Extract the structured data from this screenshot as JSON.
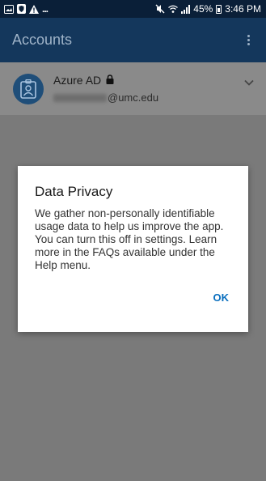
{
  "status_bar": {
    "battery": "45%",
    "time": "3:46 PM",
    "overflow": "..."
  },
  "app_bar": {
    "title": "Accounts"
  },
  "account": {
    "name": "Azure AD",
    "email_domain": "@umc.edu",
    "icon": "badge-icon",
    "lock_icon": "lock-icon"
  },
  "dialog": {
    "title": "Data Privacy",
    "body": "We gather non-personally identifiable usage data to help us improve the app. You can turn this off in settings. Learn more in the FAQs available under the Help menu.",
    "ok_label": "OK"
  },
  "colors": {
    "status_bar": "#0a1f38",
    "app_bar": "#14375c",
    "accent": "#0a6fbf",
    "scrim": "#7a7a7a"
  }
}
